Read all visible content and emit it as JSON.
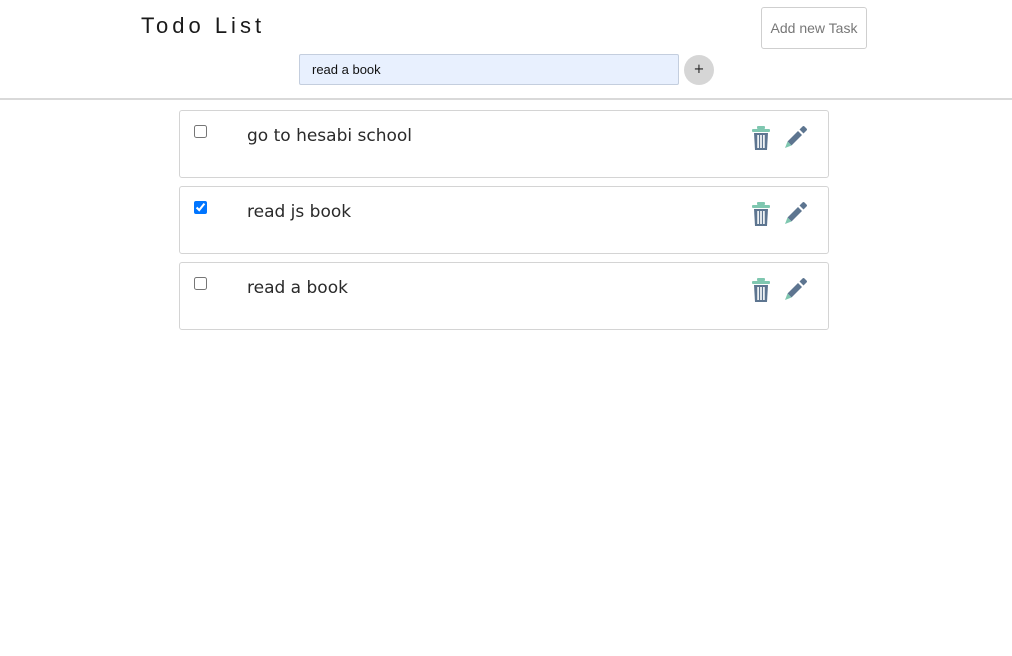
{
  "header": {
    "title": "Todo List",
    "add_task_label": "Add new Task"
  },
  "input": {
    "value": "read a book",
    "plus_label": "+"
  },
  "tasks": [
    {
      "text": "go to hesabi school",
      "checked": false
    },
    {
      "text": "read js book",
      "checked": true
    },
    {
      "text": "read a book",
      "checked": false
    }
  ],
  "icons": {
    "delete": "trash-icon",
    "edit": "pencil-icon"
  },
  "colors": {
    "icon_body": "#5d7590",
    "icon_accent": "#7fc7b0",
    "input_bg": "#e8f0fe"
  }
}
